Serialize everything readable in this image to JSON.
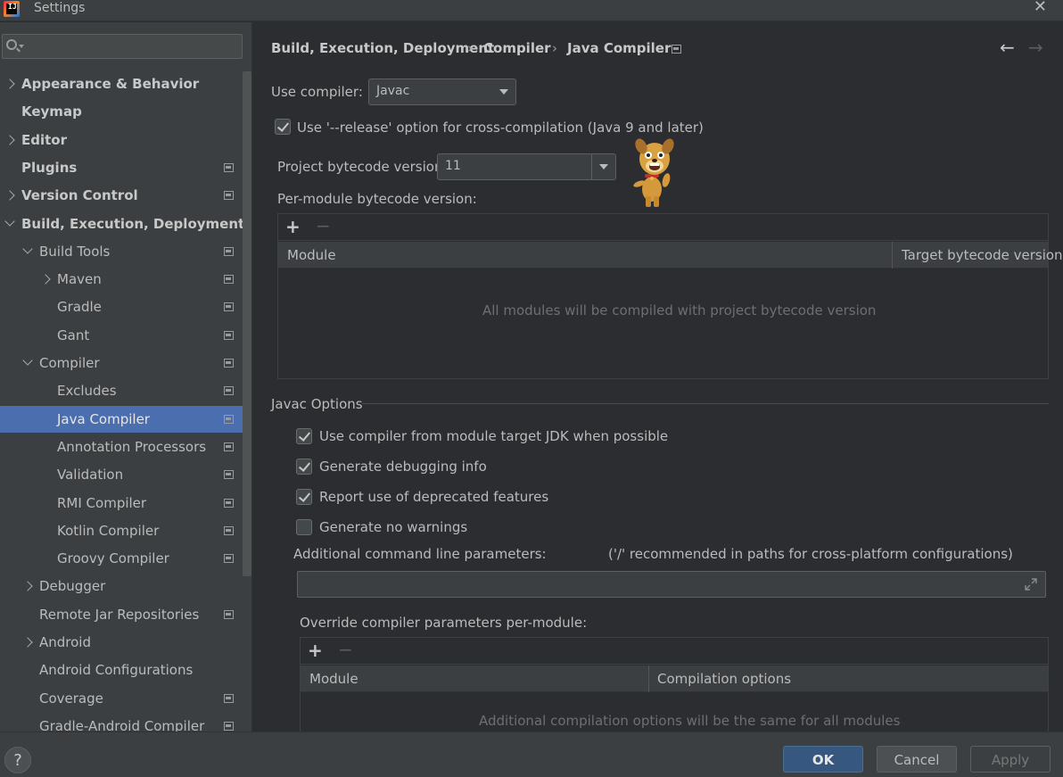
{
  "window": {
    "title": "Settings"
  },
  "search": {
    "placeholder": "",
    "value": ""
  },
  "sidebar": {
    "items": [
      {
        "label": "Appearance & Behavior",
        "level": 0,
        "bold": true,
        "expander": "right",
        "project": false
      },
      {
        "label": "Keymap",
        "level": 0,
        "bold": true,
        "expander": "none",
        "project": false
      },
      {
        "label": "Editor",
        "level": 0,
        "bold": true,
        "expander": "right",
        "project": false
      },
      {
        "label": "Plugins",
        "level": 0,
        "bold": true,
        "expander": "none",
        "project": true
      },
      {
        "label": "Version Control",
        "level": 0,
        "bold": true,
        "expander": "right",
        "project": true
      },
      {
        "label": "Build, Execution, Deployment",
        "level": 0,
        "bold": true,
        "expander": "down",
        "project": false
      },
      {
        "label": "Build Tools",
        "level": 1,
        "bold": false,
        "expander": "down",
        "project": true
      },
      {
        "label": "Maven",
        "level": 2,
        "bold": false,
        "expander": "right",
        "project": true
      },
      {
        "label": "Gradle",
        "level": 2,
        "bold": false,
        "expander": "none",
        "project": true
      },
      {
        "label": "Gant",
        "level": 2,
        "bold": false,
        "expander": "none",
        "project": true
      },
      {
        "label": "Compiler",
        "level": 1,
        "bold": false,
        "expander": "down",
        "project": true
      },
      {
        "label": "Excludes",
        "level": 2,
        "bold": false,
        "expander": "none",
        "project": true
      },
      {
        "label": "Java Compiler",
        "level": 2,
        "bold": false,
        "expander": "none",
        "project": true,
        "selected": true
      },
      {
        "label": "Annotation Processors",
        "level": 2,
        "bold": false,
        "expander": "none",
        "project": true
      },
      {
        "label": "Validation",
        "level": 2,
        "bold": false,
        "expander": "none",
        "project": true
      },
      {
        "label": "RMI Compiler",
        "level": 2,
        "bold": false,
        "expander": "none",
        "project": true
      },
      {
        "label": "Kotlin Compiler",
        "level": 2,
        "bold": false,
        "expander": "none",
        "project": true
      },
      {
        "label": "Groovy Compiler",
        "level": 2,
        "bold": false,
        "expander": "none",
        "project": true
      },
      {
        "label": "Debugger",
        "level": 1,
        "bold": false,
        "expander": "right",
        "project": false
      },
      {
        "label": "Remote Jar Repositories",
        "level": 1,
        "bold": false,
        "expander": "none",
        "project": true
      },
      {
        "label": "Android",
        "level": 1,
        "bold": false,
        "expander": "right",
        "project": false
      },
      {
        "label": "Android Configurations",
        "level": 1,
        "bold": false,
        "expander": "none",
        "project": false
      },
      {
        "label": "Coverage",
        "level": 1,
        "bold": false,
        "expander": "none",
        "project": true
      },
      {
        "label": "Gradle-Android Compiler",
        "level": 1,
        "bold": false,
        "expander": "none",
        "project": true
      }
    ]
  },
  "breadcrumb": {
    "items": [
      "Build, Execution, Deployment",
      "Compiler",
      "Java Compiler"
    ],
    "separator": "›"
  },
  "nav": {
    "back": "←",
    "forward": "→"
  },
  "compiler": {
    "use_compiler_label": "Use compiler:",
    "use_compiler_value": "Javac",
    "release_option_label": "Use '--release' option for cross-compilation (Java 9 and later)",
    "release_option_checked": true,
    "bytecode_label": "Project bytecode version:",
    "bytecode_value": "11",
    "per_module_label": "Per-module bytecode version:",
    "per_module_table": {
      "columns": [
        "Module",
        "Target bytecode version"
      ],
      "empty_text": "All modules will be compiled with project bytecode version"
    }
  },
  "javac": {
    "section_title": "Javac Options",
    "options": [
      {
        "label": "Use compiler from module target JDK when possible",
        "checked": true
      },
      {
        "label": "Generate debugging info",
        "checked": true
      },
      {
        "label": "Report use of deprecated features",
        "checked": true
      },
      {
        "label": "Generate no warnings",
        "checked": false
      }
    ],
    "cmdline_label": "Additional command line parameters:",
    "cmdline_hint": "('/' recommended in paths for cross-platform configurations)",
    "cmdline_value": "",
    "override_label": "Override compiler parameters per-module:",
    "override_table": {
      "columns": [
        "Module",
        "Compilation options"
      ],
      "empty_text": "Additional compilation options will be the same for all modules"
    }
  },
  "toolbar": {
    "add": "+",
    "remove": "−"
  },
  "footer": {
    "help": "?",
    "ok": "OK",
    "cancel": "Cancel",
    "apply": "Apply"
  },
  "colors": {
    "selection": "#4b6eaf",
    "ok_button": "#365880",
    "background": "#2b2d30",
    "panel": "#3c3f41"
  }
}
